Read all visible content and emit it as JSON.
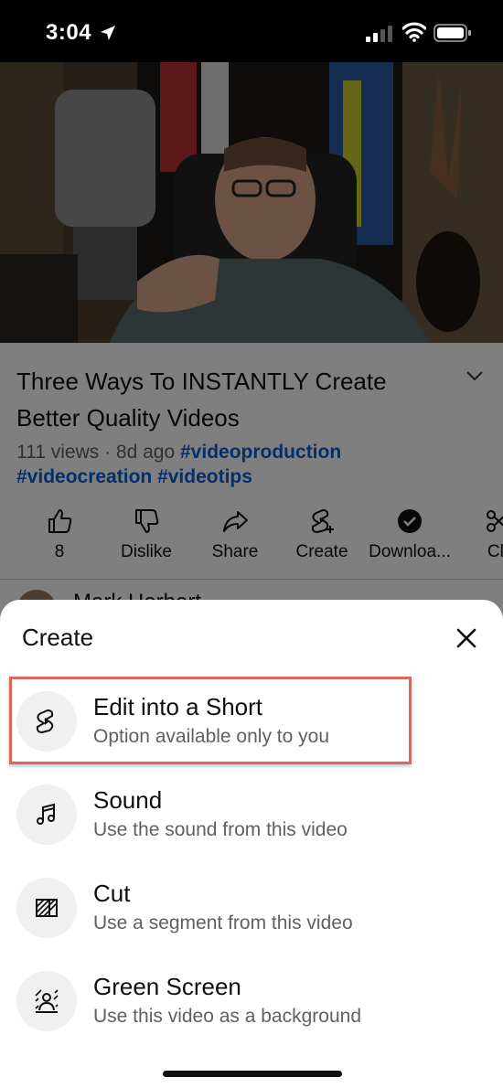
{
  "status_bar": {
    "time": "3:04"
  },
  "video_page": {
    "title": "Three Ways To INSTANTLY Create Better Quality Videos",
    "views_age": "111 views · 8d ago ",
    "tags": [
      "#videoproduction",
      "#videocreation",
      "#videotips"
    ],
    "actions": [
      {
        "label": "8",
        "icon": "thumbs-up-icon"
      },
      {
        "label": "Dislike",
        "icon": "thumbs-down-icon"
      },
      {
        "label": "Share",
        "icon": "share-icon"
      },
      {
        "label": "Create",
        "icon": "create-icon"
      },
      {
        "label": "Downloa...",
        "icon": "download-icon"
      },
      {
        "label": "Cli",
        "icon": "clip-icon"
      }
    ],
    "channel_name": "Mark Herbert"
  },
  "sheet": {
    "title": "Create",
    "options": [
      {
        "label": "Edit into a Short",
        "sub": "Option available only to you",
        "icon": "shorts-icon"
      },
      {
        "label": "Sound",
        "sub": "Use the sound from this video",
        "icon": "music-note-icon"
      },
      {
        "label": "Cut",
        "sub": "Use a segment from this video",
        "icon": "cut-segment-icon"
      },
      {
        "label": "Green Screen",
        "sub": "Use this video as a background",
        "icon": "green-screen-icon"
      }
    ]
  },
  "colors": {
    "link": "#065fd4",
    "highlight": "#e0665a",
    "scrim": "rgba(0,0,0,0.5)"
  }
}
